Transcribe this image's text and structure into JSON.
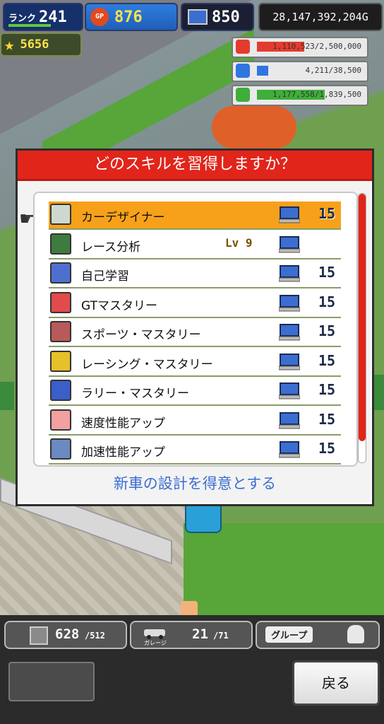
{
  "hud": {
    "rank_label": "ランク",
    "rank_value": "241",
    "gp_icon_label": "GP",
    "gp_value": "876",
    "pc_value": "850",
    "money": "28,147,392,204G",
    "stars": "5656"
  },
  "resources": [
    {
      "icon": "coin-stack-icon",
      "text": "1,110,523/2,500,000",
      "fill": 0.444,
      "color": "#e53b2f"
    },
    {
      "icon": "fuel-can-icon",
      "text": "4,211/38,500",
      "fill": 0.109,
      "color": "#2f76e0"
    },
    {
      "icon": "wheat-icon",
      "text": "1,177,558/1,839,500",
      "fill": 0.64,
      "color": "#3fae3a"
    }
  ],
  "dialog": {
    "title": "どのスキルを習得しますか？",
    "description": "新車の設計を得意とする"
  },
  "skills": [
    {
      "name": "カーデザイナー",
      "level": "",
      "cost": "15",
      "selected": true,
      "icon": "wrench-car-icon",
      "icon_color": "#cfd8cf"
    },
    {
      "name": "レース分析",
      "level": "Lv 9",
      "cost": "",
      "selected": false,
      "icon": "monitor-graph-icon",
      "icon_color": "#3f7a3f"
    },
    {
      "name": "自己学習",
      "level": "",
      "cost": "15",
      "selected": false,
      "icon": "notebook-icon",
      "icon_color": "#4f6fd0"
    },
    {
      "name": "GTマスタリー",
      "level": "",
      "cost": "15",
      "selected": false,
      "icon": "red-car-icon",
      "icon_color": "#e24b4b"
    },
    {
      "name": "スポーツ・マスタリー",
      "level": "",
      "cost": "15",
      "selected": false,
      "icon": "sports-car-icon",
      "icon_color": "#b85a5a"
    },
    {
      "name": "レーシング・マスタリー",
      "level": "",
      "cost": "15",
      "selected": false,
      "icon": "racing-helmet-icon",
      "icon_color": "#e6c12a"
    },
    {
      "name": "ラリー・マスタリー",
      "level": "",
      "cost": "15",
      "selected": false,
      "icon": "rally-car-icon",
      "icon_color": "#3b5fc8"
    },
    {
      "name": "速度性能アップ",
      "level": "",
      "cost": "15",
      "selected": false,
      "icon": "speed-car-icon",
      "icon_color": "#f2a0a0"
    },
    {
      "name": "加速性能アップ",
      "level": "",
      "cost": "15",
      "selected": false,
      "icon": "hammer-icon",
      "icon_color": "#6a8ac0"
    }
  ],
  "bottom": {
    "storage_value": "628",
    "storage_max": "/512",
    "garage_label": "ガレージ",
    "garage_value": "21",
    "garage_max": "/71",
    "group_label": "グループ",
    "back_label": "戻る"
  }
}
